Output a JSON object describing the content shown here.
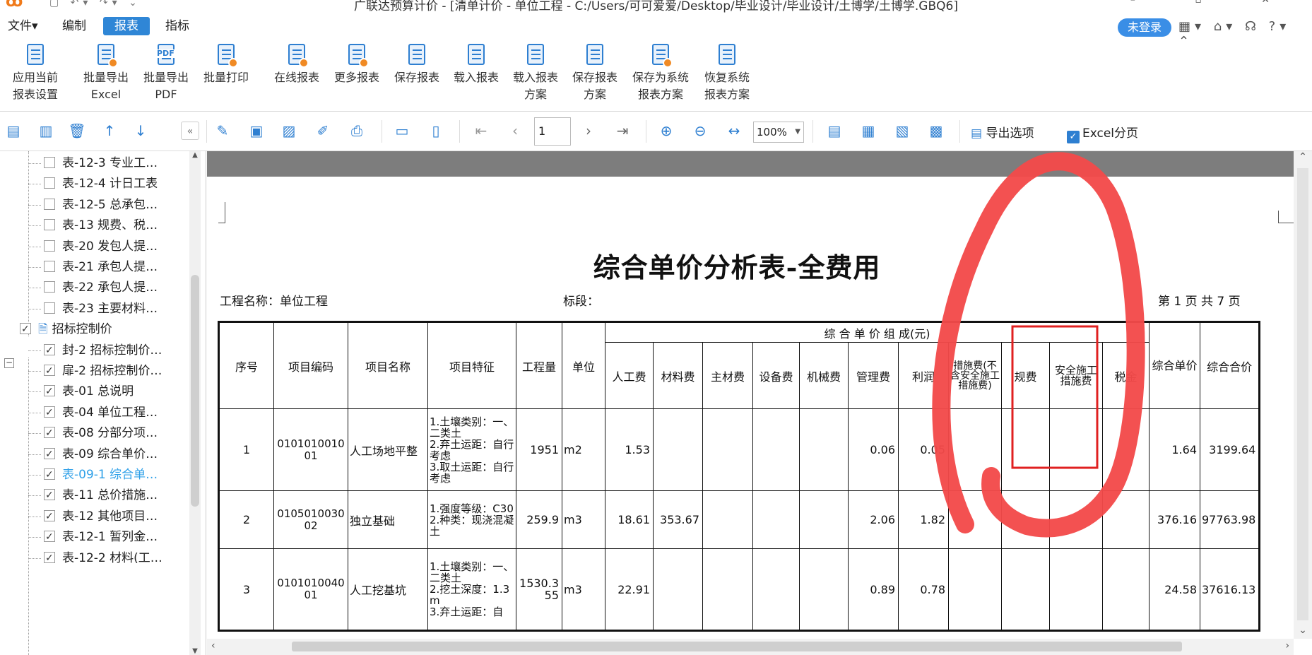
{
  "window": {
    "title": "广联达预算计价 - [清单计价 - 单位工程 - C:/Users/可可爱爱/Desktop/毕业设计/毕业设计/土博学/土博学.GBQ6]"
  },
  "menu": [
    "文件▾",
    "编制",
    "报表",
    "指标"
  ],
  "menu_active": "报表",
  "login_label": "未登录",
  "ribbon": [
    {
      "line1": "应用当前",
      "line2": "报表设置",
      "icon": "apply-settings-icon"
    },
    {
      "line1": "批量导出",
      "line2": "Excel",
      "icon": "export-excel-icon"
    },
    {
      "line1": "批量导出",
      "line2": "PDF",
      "icon": "export-pdf-icon"
    },
    {
      "line1": "批量打印",
      "line2": "",
      "icon": "print-icon"
    },
    {
      "line1": "在线报表",
      "line2": "",
      "icon": "online-report-icon"
    },
    {
      "line1": "更多报表",
      "line2": "",
      "icon": "more-reports-icon"
    },
    {
      "line1": "保存报表",
      "line2": "",
      "icon": "save-report-icon"
    },
    {
      "line1": "载入报表",
      "line2": "",
      "icon": "load-report-icon"
    },
    {
      "line1": "载入报表",
      "line2": "方案",
      "icon": "load-scheme-icon"
    },
    {
      "line1": "保存报表",
      "line2": "方案",
      "icon": "save-scheme-icon"
    },
    {
      "line1": "保存为系统",
      "line2": "报表方案",
      "icon": "save-system-scheme-icon"
    },
    {
      "line1": "恢复系统",
      "line2": "报表方案",
      "icon": "restore-system-scheme-icon"
    }
  ],
  "toolbar": {
    "page_value": "1",
    "zoom_value": "100%",
    "export_options_label": "导出选项",
    "excel_paging_label": "Excel分页"
  },
  "tree": [
    {
      "label": "表-12-3 专业工…",
      "checked": false,
      "level": 2
    },
    {
      "label": "表-12-4 计日工表",
      "checked": false,
      "level": 2
    },
    {
      "label": "表-12-5 总承包…",
      "checked": false,
      "level": 2
    },
    {
      "label": "表-13 规费、税…",
      "checked": false,
      "level": 2
    },
    {
      "label": "表-20 发包人提…",
      "checked": false,
      "level": 2
    },
    {
      "label": "表-21 承包人提…",
      "checked": false,
      "level": 2
    },
    {
      "label": "表-22 承包人提…",
      "checked": false,
      "level": 2
    },
    {
      "label": "表-23 主要材料…",
      "checked": false,
      "level": 2
    },
    {
      "label": "招标控制价",
      "checked": true,
      "level": 1
    },
    {
      "label": "封-2 招标控制价…",
      "checked": true,
      "level": 2
    },
    {
      "label": "扉-2 招标控制价…",
      "checked": true,
      "level": 2
    },
    {
      "label": "表-01 总说明",
      "checked": true,
      "level": 2
    },
    {
      "label": "表-04 单位工程…",
      "checked": true,
      "level": 2
    },
    {
      "label": "表-08 分部分项…",
      "checked": true,
      "level": 2
    },
    {
      "label": "表-09 综合单价…",
      "checked": true,
      "level": 2
    },
    {
      "label": "表-09-1 综合单…",
      "checked": true,
      "level": 2,
      "selected": true
    },
    {
      "label": "表-11 总价措施…",
      "checked": true,
      "level": 2
    },
    {
      "label": "表-12 其他项目…",
      "checked": true,
      "level": 2
    },
    {
      "label": "表-12-1 暂列金…",
      "checked": true,
      "level": 2
    },
    {
      "label": "表-12-2 材料(工…",
      "checked": true,
      "level": 2
    }
  ],
  "report": {
    "title": "综合单价分析表-全费用",
    "project_label": "工程名称：单位工程",
    "section_label": "标段：",
    "page_label": "第 1 页 共 7 页",
    "group_header": "综 合 单 价 组 成(元)",
    "headers": {
      "seq": "序号",
      "code": "项目编码",
      "name": "项目名称",
      "feature": "项目特征",
      "qty": "工程量",
      "unit": "单位",
      "labor": "人工费",
      "material": "材料费",
      "main_material": "主材费",
      "equipment": "设备费",
      "machine": "机械费",
      "mgmt": "管理费",
      "profit": "利润",
      "measures": "措施费(不含安全施工措施费)",
      "fees": "规费",
      "safety": "安全施工措施费",
      "tax": "税金",
      "unit_price": "综合单价",
      "total": "综合合价"
    },
    "rows": [
      {
        "seq": "1",
        "code": "010101001001",
        "name": "人工场地平整",
        "feature": "1.土壤类别：一、二类土\n2.弃土运距：自行考虑\n3.取土运距：自行考虑",
        "qty": "1951",
        "unit": "m2",
        "labor": "1.53",
        "material": "",
        "main_material": "",
        "equipment": "",
        "machine": "",
        "mgmt": "0.06",
        "profit": "0.05",
        "measures": "",
        "fees": "",
        "safety": "",
        "tax": "",
        "unit_price": "1.64",
        "total": "3199.64"
      },
      {
        "seq": "2",
        "code": "010501003002",
        "name": "独立基础",
        "feature": "1.强度等级：C30\n2.种类：现浇混凝土",
        "qty": "259.9",
        "unit": "m3",
        "labor": "18.61",
        "material": "353.67",
        "main_material": "",
        "equipment": "",
        "machine": "",
        "mgmt": "2.06",
        "profit": "1.82",
        "measures": "",
        "fees": "",
        "safety": "",
        "tax": "",
        "unit_price": "376.16",
        "total": "97763.98"
      },
      {
        "seq": "3",
        "code": "010101004001",
        "name": "人工挖基坑",
        "feature": "1.土壤类别：一、二类土\n2.挖土深度：1.3m\n3.弃土运距：自",
        "qty": "1530.355",
        "unit": "m3",
        "labor": "22.91",
        "material": "",
        "main_material": "",
        "equipment": "",
        "machine": "",
        "mgmt": "0.89",
        "profit": "0.78",
        "measures": "",
        "fees": "",
        "safety": "",
        "tax": "",
        "unit_price": "24.58",
        "total": "37616.13"
      }
    ]
  },
  "colors": {
    "accent": "#2f86d6",
    "annotation_red": "#f24a4a",
    "box_red": "#e02020",
    "selected_text": "#2fa0e8"
  }
}
